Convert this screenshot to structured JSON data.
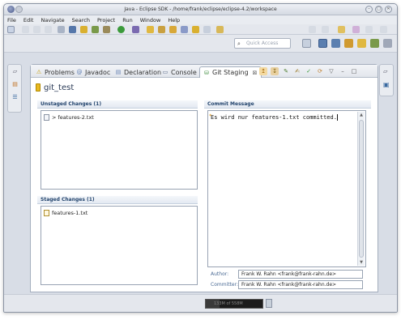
{
  "window": {
    "title": "Java - Eclipse SDK - /home/frank/eclipse/eclipse-4.2/workspace"
  },
  "menubar": {
    "items": [
      "File",
      "Edit",
      "Navigate",
      "Search",
      "Project",
      "Run",
      "Window",
      "Help"
    ]
  },
  "toolbar": {
    "quick_access_placeholder": "Quick Access"
  },
  "tabs": [
    {
      "label": "Problems",
      "icon": "problems-icon",
      "active": false
    },
    {
      "label": "Javadoc",
      "icon": "javadoc-icon",
      "active": false
    },
    {
      "label": "Declaration",
      "icon": "declaration-icon",
      "active": false
    },
    {
      "label": "Console",
      "icon": "console-icon",
      "active": false
    },
    {
      "label": "Git Staging",
      "icon": "git-staging-icon",
      "active": true,
      "close": "⊠"
    }
  ],
  "git_staging": {
    "repository": "git_test",
    "unstaged": {
      "header": "Unstaged Changes (1)",
      "files": [
        "> features-2.txt"
      ]
    },
    "staged": {
      "header": "Staged Changes (1)",
      "files": [
        "features-1.txt"
      ]
    },
    "commit": {
      "header": "Commit Message",
      "message": "Es wird nur features-1.txt committed."
    },
    "author": {
      "label": "Author:",
      "value": "Frank W. Rahn <frank@frank-rahn.de>"
    },
    "committer": {
      "label": "Committer:",
      "value": "Frank W. Rahn <frank@frank-rahn.de>"
    }
  },
  "statusbar": {
    "heap": "133M of 558M"
  },
  "colors": {
    "section_header_text": "#24456e",
    "label_text": "#4a6a94",
    "repo_icon": "#e8b820"
  }
}
